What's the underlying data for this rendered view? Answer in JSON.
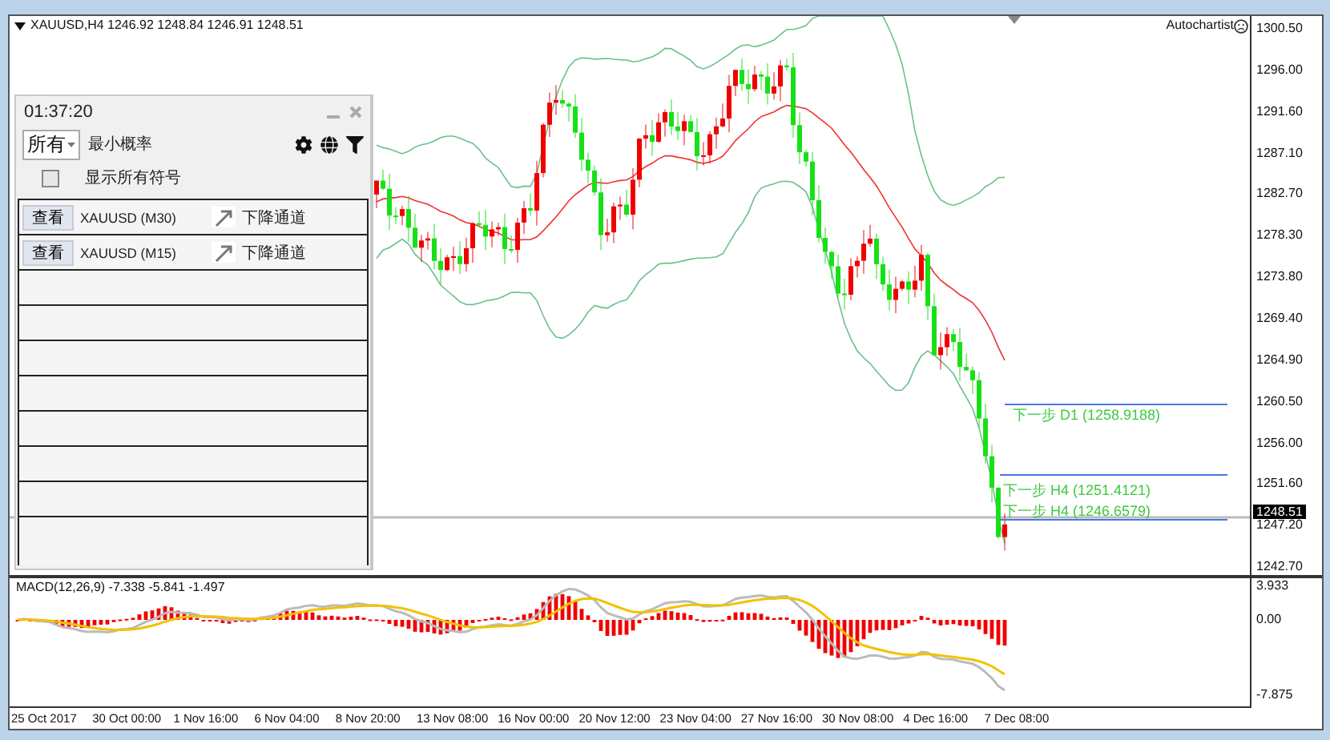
{
  "chart": {
    "header": "XAUUSD,H4  1246.92 1248.84 1246.91 1248.51",
    "badge": "Autochartist",
    "price_axis": [
      "1300.50",
      "1296.00",
      "1291.60",
      "1287.10",
      "1282.70",
      "1278.30",
      "1273.80",
      "1269.40",
      "1264.90",
      "1260.50",
      "1256.00",
      "1251.60",
      "1247.20",
      "1242.70"
    ],
    "current_price": "1248.51",
    "levels": [
      {
        "label": "下一步 D1 (1258.9188)"
      },
      {
        "label": "下一步 H4 (1251.4121)"
      },
      {
        "label": "下一步 H4 (1246.6579)"
      }
    ],
    "macd": {
      "label": "MACD(12,26,9) -7.338 -5.841 -1.497",
      "axis": [
        "3.933",
        "0.00",
        "-7.875"
      ]
    },
    "time_axis": [
      "25 Oct 2017",
      "30 Oct 00:00",
      "1 Nov 16:00",
      "6 Nov 04:00",
      "8 Nov 20:00",
      "13 Nov 08:00",
      "16 Nov 00:00",
      "20 Nov 12:00",
      "23 Nov 04:00",
      "27 Nov 16:00",
      "30 Nov 08:00",
      "4 Dec 16:00",
      "7 Dec 08:00"
    ]
  },
  "panel": {
    "clock": "01:37:20",
    "filter": {
      "value": "所有",
      "label": "最小概率"
    },
    "show_all": {
      "label": "显示所有符号",
      "checked": false
    },
    "rows": [
      {
        "button": "查看",
        "symbol": "XAUUSD (M30)",
        "pattern": "下降通道"
      },
      {
        "button": "查看",
        "symbol": "XAUUSD (M15)",
        "pattern": "下降通道"
      }
    ]
  }
}
